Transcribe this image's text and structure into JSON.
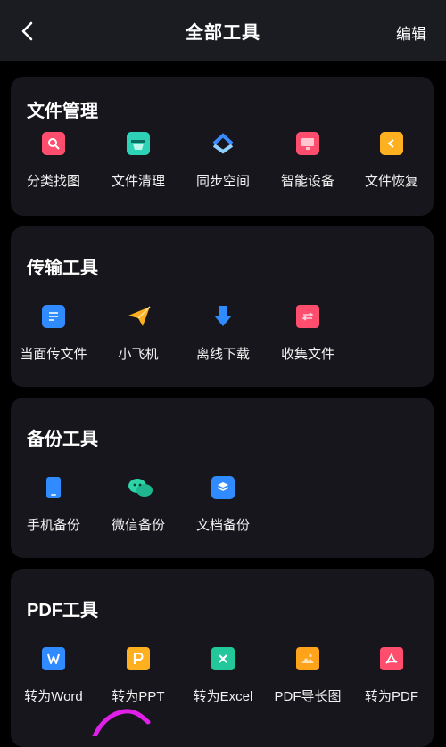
{
  "header": {
    "title": "全部工具",
    "edit_label": "编辑"
  },
  "sections": [
    {
      "title": "文件管理",
      "items": [
        {
          "label": "分类找图",
          "icon": "image-search-icon",
          "color": "#ff4d6d"
        },
        {
          "label": "文件清理",
          "icon": "clean-basket-icon",
          "color": "#2ed3b7"
        },
        {
          "label": "同步空间",
          "icon": "sync-space-icon",
          "color": "#3a8bff"
        },
        {
          "label": "智能设备",
          "icon": "smart-device-icon",
          "color": "#ff4d6d"
        },
        {
          "label": "文件恢复",
          "icon": "file-restore-icon",
          "color": "#ffb020"
        }
      ]
    },
    {
      "title": "传输工具",
      "items": [
        {
          "label": "当面传文件",
          "icon": "face-transfer-icon",
          "color": "#2f8bff"
        },
        {
          "label": "小飞机",
          "icon": "paper-plane-icon",
          "color": "#ffb020"
        },
        {
          "label": "离线下载",
          "icon": "download-arrow-icon",
          "color": "#2f8bff"
        },
        {
          "label": "收集文件",
          "icon": "folder-collect-icon",
          "color": "#ff4d6d"
        }
      ]
    },
    {
      "title": "备份工具",
      "items": [
        {
          "label": "手机备份",
          "icon": "phone-backup-icon",
          "color": "#2f8bff"
        },
        {
          "label": "微信备份",
          "icon": "wechat-icon",
          "color": "#2ed3a7"
        },
        {
          "label": "文档备份",
          "icon": "doc-backup-icon",
          "color": "#2f8bff"
        }
      ]
    },
    {
      "title": "PDF工具",
      "items": [
        {
          "label": "转为Word",
          "icon": "word-file-icon",
          "color": "#2f8bff"
        },
        {
          "label": "转为PPT",
          "icon": "ppt-file-icon",
          "color": "#ffb020"
        },
        {
          "label": "转为Excel",
          "icon": "excel-file-icon",
          "color": "#22c79a"
        },
        {
          "label": "PDF导长图",
          "icon": "long-image-icon",
          "color": "#ffa31a"
        },
        {
          "label": "转为PDF",
          "icon": "pdf-file-icon",
          "color": "#ff4d6d"
        }
      ]
    }
  ]
}
